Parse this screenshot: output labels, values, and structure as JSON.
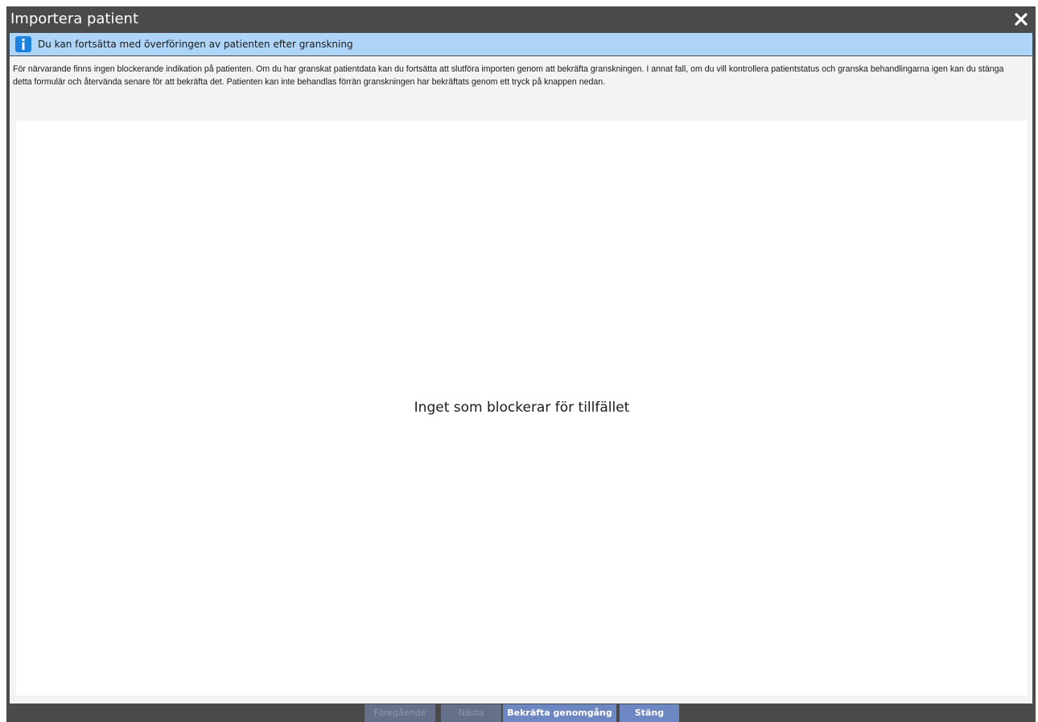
{
  "window": {
    "title": "Importera patient",
    "close_icon": "close-icon"
  },
  "info_banner": {
    "icon": "info-icon",
    "text": "Du kan fortsätta med överföringen av patienten efter granskning",
    "color": "#aed5f8",
    "icon_color": "#1b82e0"
  },
  "description": {
    "text": "För närvarande finns ingen blockerande indikation på patienten. Om du har granskat patientdata kan du fortsätta att slutföra importen genom att bekräfta granskningen. I annat fall, om du vill kontrollera patientstatus och granska behandlingarna igen kan du stänga detta formulär och återvända senare för att bekräfta det. Patienten kan inte behandlas förrän granskningen har bekräftats genom ett tryck på knappen nedan."
  },
  "content": {
    "empty_message": "Inget som blockerar för tillfället"
  },
  "buttons": {
    "previous": {
      "label": "Föregående",
      "enabled": false
    },
    "next": {
      "label": "Nästa",
      "enabled": false
    },
    "confirm_review": {
      "label": "Bekräfta genomgång",
      "enabled": true
    },
    "close": {
      "label": "Stäng",
      "enabled": true
    }
  },
  "colors": {
    "window_chrome": "#4a4a4a",
    "button_active": "#6c87c2",
    "button_disabled": "#66708a"
  }
}
